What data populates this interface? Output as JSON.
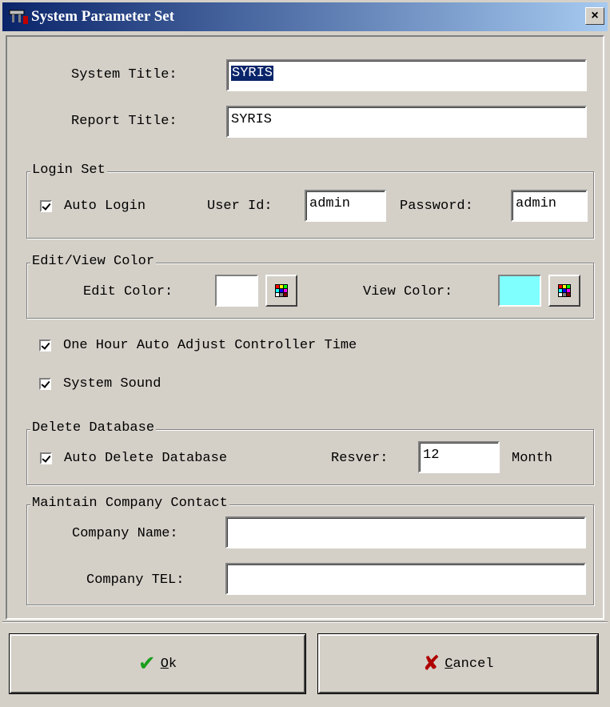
{
  "window": {
    "title": "System Parameter Set",
    "close_label": "×"
  },
  "general": {
    "system_title_label": "System Title:",
    "system_title_value": "SYRIS",
    "report_title_label": "Report Title:",
    "report_title_value": "SYRIS"
  },
  "login": {
    "group_title": "Login Set",
    "auto_login_label": "Auto Login",
    "auto_login_checked": true,
    "user_id_label": "User Id:",
    "user_id_value": "admin",
    "password_label": "Password:",
    "password_value": "admin"
  },
  "colors": {
    "group_title": "Edit/View Color",
    "edit_color_label": "Edit Color:",
    "edit_color": "#ffffff",
    "view_color_label": "View Color:",
    "view_color": "#80ffff",
    "palette_icon": "palette-grid-icon"
  },
  "options": {
    "auto_adjust_label": "One Hour Auto Adjust Controller Time",
    "auto_adjust_checked": true,
    "system_sound_label": "System Sound",
    "system_sound_checked": true
  },
  "delete_db": {
    "group_title": "Delete Database",
    "auto_delete_label": "Auto Delete Database",
    "auto_delete_checked": true,
    "reserve_label": "Resver:",
    "reserve_value": "12",
    "unit_label": "Month"
  },
  "company": {
    "group_title": "Maintain Company Contact",
    "name_label": "Company Name:",
    "name_value": "",
    "tel_label": "Company TEL:",
    "tel_value": ""
  },
  "buttons": {
    "ok_label": "Ok",
    "ok_icon": "checkmark-icon",
    "cancel_label": "Cancel",
    "cancel_icon": "x-mark-icon"
  }
}
